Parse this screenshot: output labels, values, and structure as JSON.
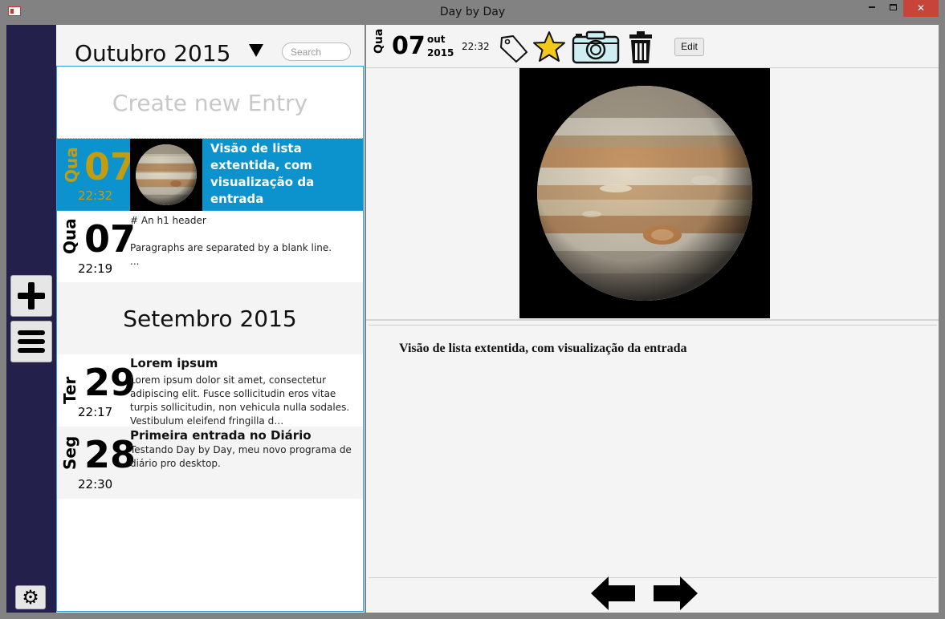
{
  "window": {
    "title": "Day by Day"
  },
  "list": {
    "month_label": "Outubro 2015",
    "search_placeholder": "Search",
    "create_label": "Create new Entry",
    "separator_label": "Setembro 2015",
    "entries": [
      {
        "weekday": "Qua",
        "day": "07",
        "time": "22:32",
        "title": "Visão de lista extentida, com visualização da entrada",
        "body": ""
      },
      {
        "weekday": "Qua",
        "day": "07",
        "time": "22:19",
        "title": "",
        "body_lines": [
          "# An h1 header",
          "",
          "Paragraphs are separated by a blank line.",
          "..."
        ]
      },
      {
        "weekday": "Ter",
        "day": "29",
        "time": "22:17",
        "title": "Lorem ipsum",
        "body": "Lorem ipsum dolor sit amet, consectetur adipiscing elit. Fusce sollicitudin eros vitae turpis sollicitudin, non vehicula nulla sodales. Vestibulum eleifend fringilla d…"
      },
      {
        "weekday": "Seg",
        "day": "28",
        "time": "22:30",
        "title": "Primeira entrada no Diário",
        "body": "Testando Day by Day, meu novo programa de diário pro desktop."
      }
    ]
  },
  "viewer": {
    "weekday": "Qua",
    "day": "07",
    "month": "out",
    "year": "2015",
    "time": "22:32",
    "edit_label": "Edit",
    "entry_text": "Visão de lista extentida, com visualização da entrada"
  },
  "colors": {
    "rail": "#23204b",
    "selection": "#0c93cd",
    "selection_date": "#c29d12",
    "star": "#f2c81b",
    "camera": "#cdeff2",
    "close_button": "#c7443b"
  },
  "icons": [
    "tag-icon",
    "star-icon",
    "camera-icon",
    "trash-icon",
    "plus-icon",
    "menu-icon",
    "gear-icon",
    "arrow-left-icon",
    "arrow-right-icon"
  ]
}
